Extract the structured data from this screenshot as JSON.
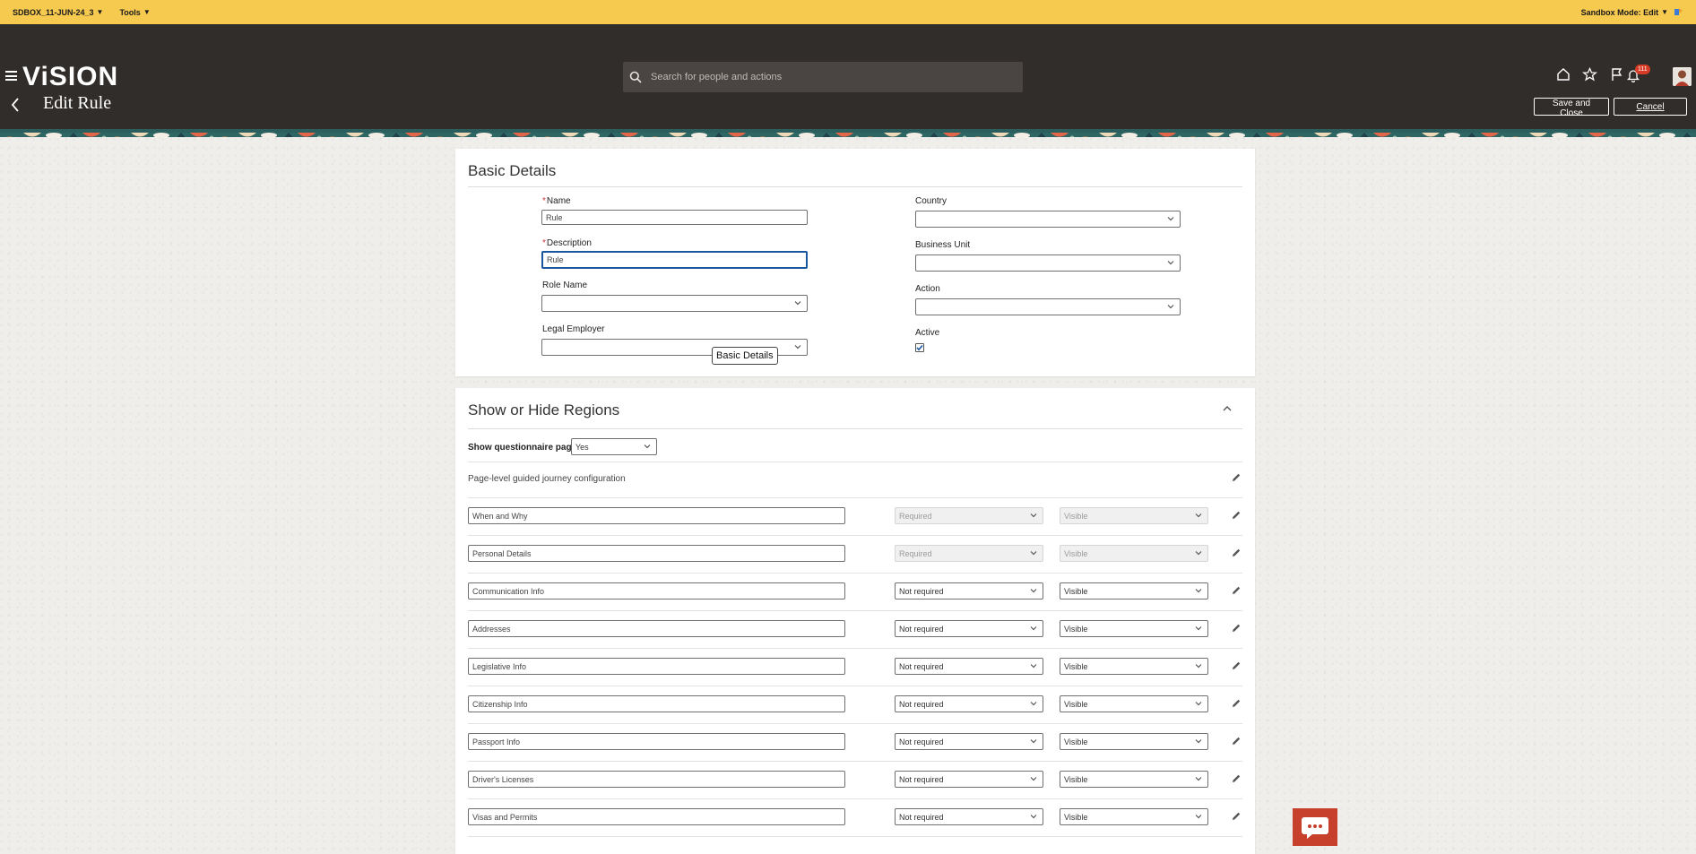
{
  "sandbox_bar": {
    "sandbox_name": "SDBOX_11-JUN-24_3",
    "tools_label": "Tools",
    "mode_label": "Sandbox Mode: Edit"
  },
  "header": {
    "logo": "ViSION",
    "search_placeholder": "Search for people and actions",
    "notifications_count": "111",
    "page_title": "Edit Rule",
    "save_close_label": "Save and Close",
    "cancel_label": "Cancel"
  },
  "basic_details": {
    "title": "Basic Details",
    "tooltip": "Basic Details",
    "name": {
      "label": "Name",
      "value": "Rule",
      "required": "*"
    },
    "description": {
      "label": "Description",
      "value": "Rule",
      "required": "*"
    },
    "role_name": {
      "label": "Role Name",
      "value": ""
    },
    "legal_employer": {
      "label": "Legal Employer",
      "value": ""
    },
    "country": {
      "label": "Country",
      "value": ""
    },
    "business_unit": {
      "label": "Business Unit",
      "value": ""
    },
    "action": {
      "label": "Action",
      "value": ""
    },
    "active": {
      "label": "Active",
      "checked": true
    }
  },
  "regions": {
    "title": "Show or Hide Regions",
    "questionnaire_label": "Show questionnaire page",
    "questionnaire_value": "Yes",
    "page_level_label": "Page-level guided journey configuration",
    "rows": [
      {
        "name": "When and Why",
        "required": "Required",
        "visibility": "Visible",
        "disabled": true
      },
      {
        "name": "Personal Details",
        "required": "Required",
        "visibility": "Visible",
        "disabled": true
      },
      {
        "name": "Communication Info",
        "required": "Not required",
        "visibility": "Visible",
        "disabled": false
      },
      {
        "name": "Addresses",
        "required": "Not required",
        "visibility": "Visible",
        "disabled": false
      },
      {
        "name": "Legislative Info",
        "required": "Not required",
        "visibility": "Visible",
        "disabled": false
      },
      {
        "name": "Citizenship Info",
        "required": "Not required",
        "visibility": "Visible",
        "disabled": false
      },
      {
        "name": "Passport Info",
        "required": "Not required",
        "visibility": "Visible",
        "disabled": false
      },
      {
        "name": "Driver's Licenses",
        "required": "Not required",
        "visibility": "Visible",
        "disabled": false
      },
      {
        "name": "Visas and Permits",
        "required": "Not required",
        "visibility": "Visible",
        "disabled": false
      }
    ]
  },
  "colors": {
    "sandbox_bar": "#f6c94f",
    "header_bg": "#312d2a",
    "focus_border": "#1b57a0",
    "chat_button": "#c7402c"
  }
}
